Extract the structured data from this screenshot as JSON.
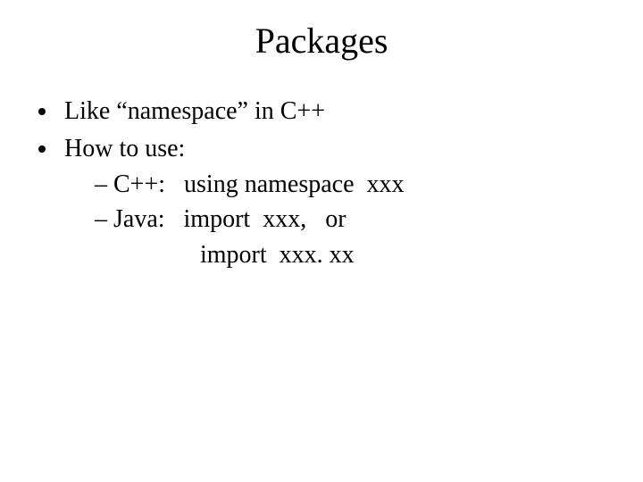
{
  "title": "Packages",
  "bullets": {
    "b1": "Like “namespace” in C++",
    "b2": "How to use:",
    "sub1": "– C++:   using namespace  xxx",
    "sub2": "– Java:   import  xxx,   or",
    "sub3": "import  xxx. xx"
  }
}
